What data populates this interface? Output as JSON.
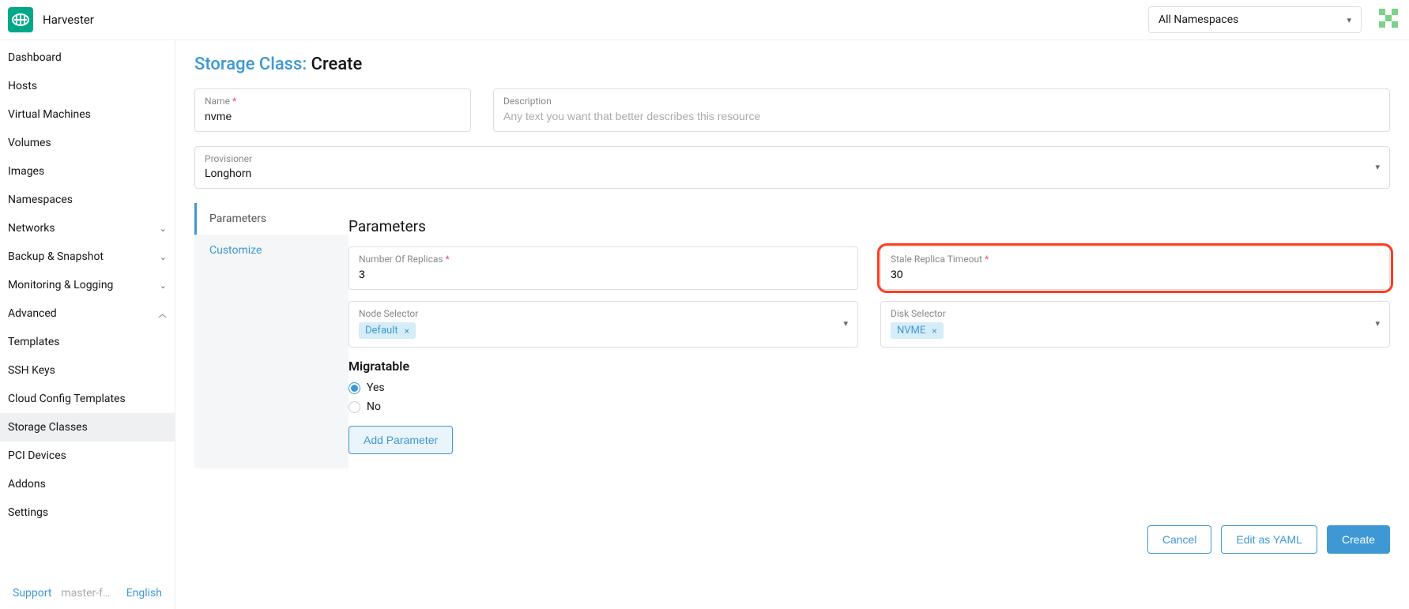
{
  "header": {
    "brand": "Harvester",
    "namespace_label": "All Namespaces"
  },
  "sidebar": {
    "items": [
      {
        "label": "Dashboard"
      },
      {
        "label": "Hosts"
      },
      {
        "label": "Virtual Machines"
      },
      {
        "label": "Volumes"
      },
      {
        "label": "Images"
      },
      {
        "label": "Namespaces"
      },
      {
        "label": "Networks",
        "expandable": true,
        "expanded": false
      },
      {
        "label": "Backup & Snapshot",
        "expandable": true,
        "expanded": false
      },
      {
        "label": "Monitoring & Logging",
        "expandable": true,
        "expanded": false
      },
      {
        "label": "Advanced",
        "expandable": true,
        "expanded": true,
        "children": [
          {
            "label": "Templates"
          },
          {
            "label": "SSH Keys"
          },
          {
            "label": "Cloud Config Templates"
          },
          {
            "label": "Storage Classes",
            "active": true
          },
          {
            "label": "PCI Devices"
          },
          {
            "label": "Addons"
          },
          {
            "label": "Settings"
          }
        ]
      }
    ],
    "footer": {
      "support": "Support",
      "version": "master-f…",
      "language": "English"
    }
  },
  "page": {
    "breadcrumb": "Storage Class:",
    "action": "Create",
    "name_label": "Name",
    "name_value": "nvme",
    "desc_label": "Description",
    "desc_placeholder": "Any text you want that better describes this resource",
    "provisioner_label": "Provisioner",
    "provisioner_value": "Longhorn",
    "tabs": {
      "parameters": "Parameters",
      "customize": "Customize"
    },
    "panel_title": "Parameters",
    "replicas_label": "Number Of Replicas",
    "replicas_value": "3",
    "stale_label": "Stale Replica Timeout",
    "stale_value": "30",
    "node_selector_label": "Node Selector",
    "node_selector_tags": [
      "Default"
    ],
    "disk_selector_label": "Disk Selector",
    "disk_selector_tags": [
      "NVME"
    ],
    "migratable_label": "Migratable",
    "migratable_options": {
      "yes": "Yes",
      "no": "No"
    },
    "add_param": "Add Parameter",
    "cancel": "Cancel",
    "edit_yaml": "Edit as YAML",
    "create": "Create"
  }
}
